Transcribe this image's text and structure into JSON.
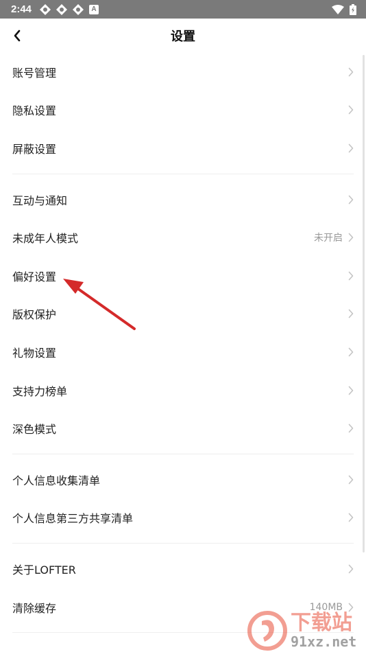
{
  "status_bar": {
    "time": "2:44",
    "a_label": "A"
  },
  "header": {
    "title": "设置"
  },
  "groups": [
    [
      {
        "label": "账号管理",
        "value": ""
      },
      {
        "label": "隐私设置",
        "value": ""
      },
      {
        "label": "屏蔽设置",
        "value": ""
      }
    ],
    [
      {
        "label": "互动与通知",
        "value": ""
      },
      {
        "label": "未成年人模式",
        "value": "未开启"
      },
      {
        "label": "偏好设置",
        "value": ""
      },
      {
        "label": "版权保护",
        "value": ""
      },
      {
        "label": "礼物设置",
        "value": ""
      },
      {
        "label": "支持力榜单",
        "value": ""
      },
      {
        "label": "深色模式",
        "value": ""
      }
    ],
    [
      {
        "label": "个人信息收集清单",
        "value": ""
      },
      {
        "label": "个人信息第三方共享清单",
        "value": ""
      }
    ],
    [
      {
        "label": "关于LOFTER",
        "value": ""
      },
      {
        "label": "清除缓存",
        "value": "140MB"
      }
    ]
  ],
  "watermark": {
    "title": "下载站",
    "url": "91xz.net"
  },
  "colors": {
    "status_bar": "#7a7a7a",
    "chevron": "#c4c4c4",
    "value_text": "#999999",
    "arrow": "#d42a2a"
  }
}
